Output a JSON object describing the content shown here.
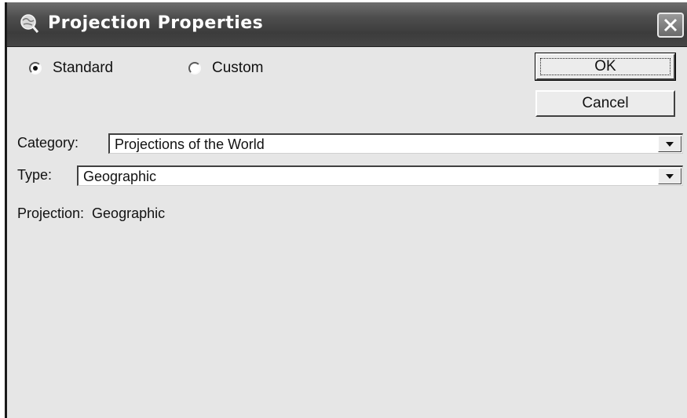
{
  "window": {
    "title": "Projection Properties",
    "title_icon": "globe-magnifier-icon",
    "close_icon": "close-icon"
  },
  "mode": {
    "selected": "Standard",
    "options": [
      {
        "label": "Standard",
        "checked": true
      },
      {
        "label": "Custom",
        "checked": false
      }
    ]
  },
  "buttons": {
    "ok_label": "OK",
    "cancel_label": "Cancel"
  },
  "category": {
    "label": "Category:",
    "value": "Projections of the World"
  },
  "type": {
    "label": "Type:",
    "value": "Geographic"
  },
  "projection": {
    "label": "Projection:",
    "value": "Geographic"
  },
  "colors": {
    "dialog_background": "#e6e6e6",
    "titlebar": "#4d4d4d",
    "title_text": "#ffffff"
  }
}
